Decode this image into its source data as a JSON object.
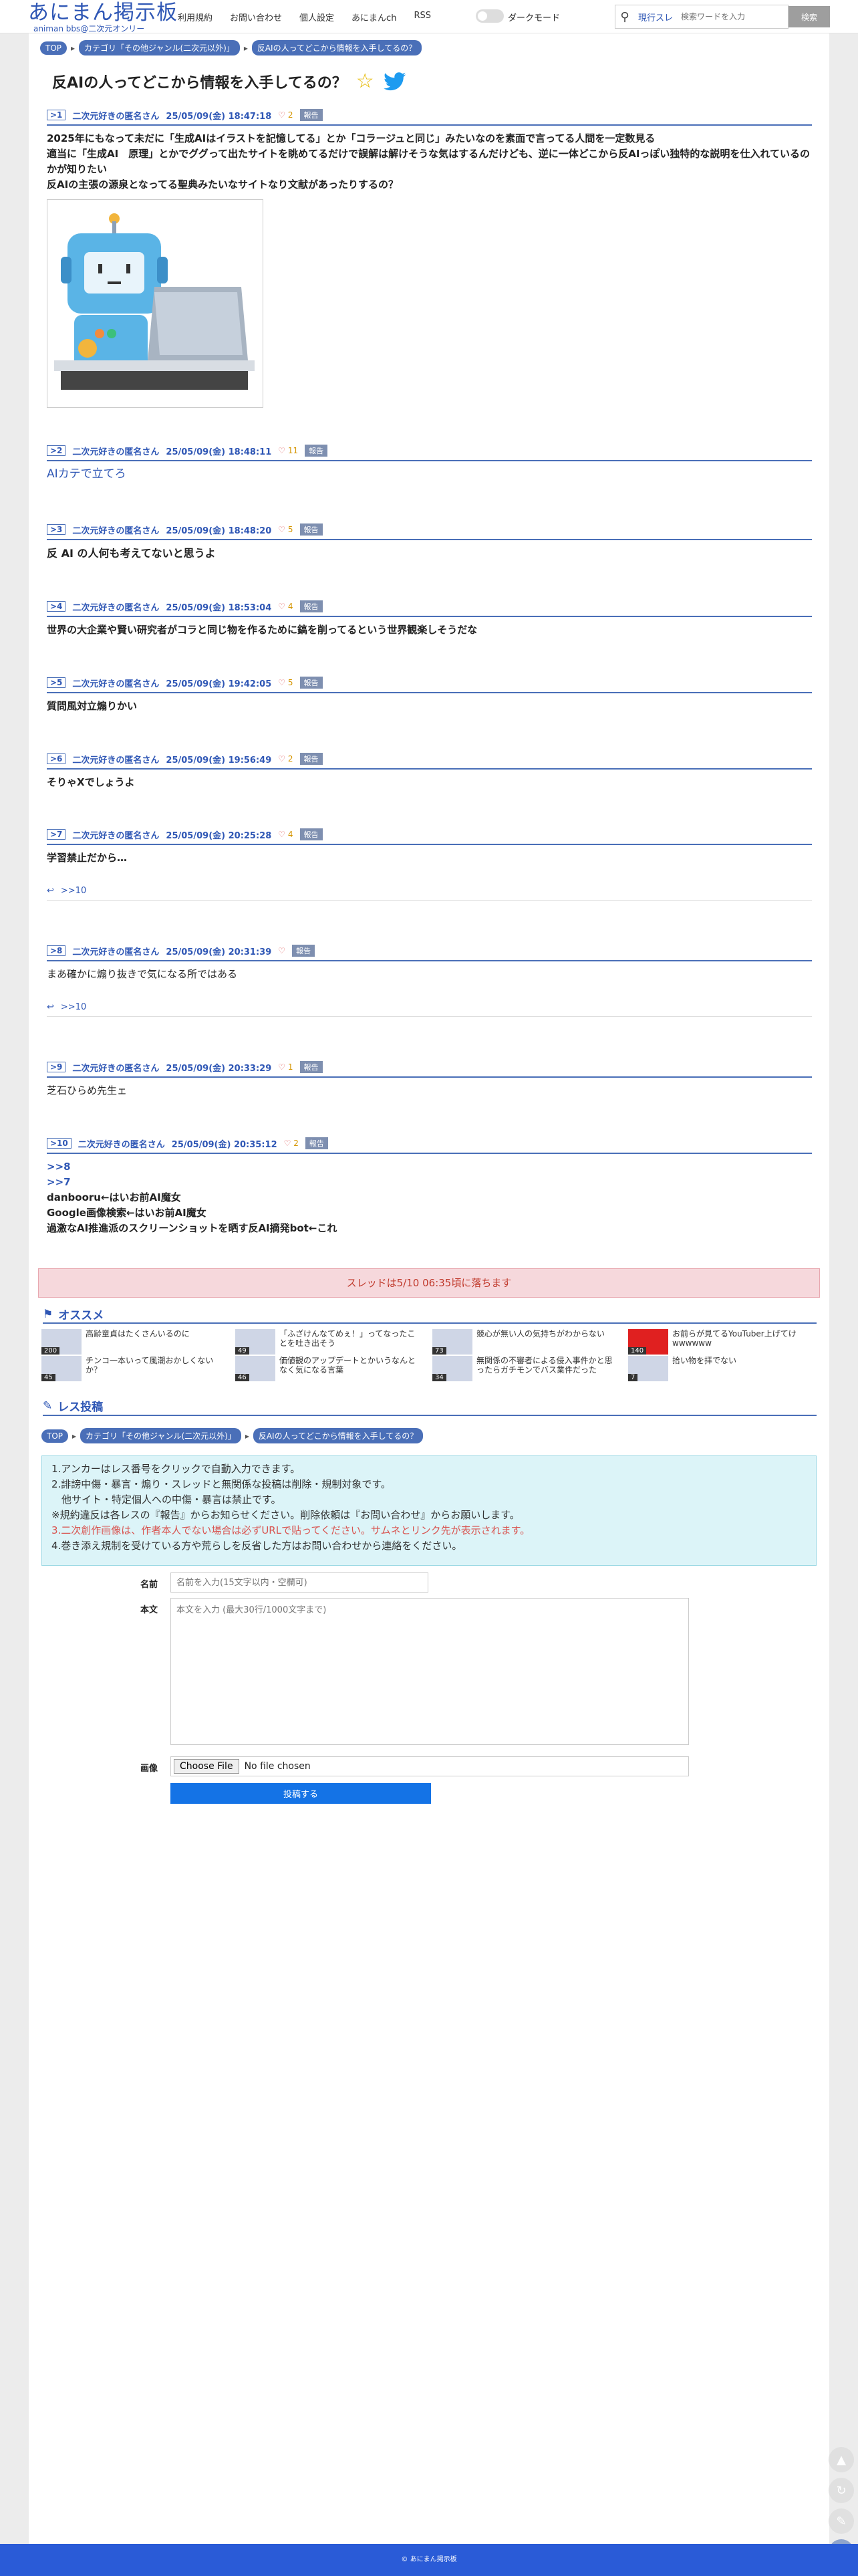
{
  "header": {
    "logo_main": "あにまん掲示板",
    "logo_sub": "animan bbs@二次元オンリー",
    "nav": [
      "利用規約",
      "お問い合わせ",
      "個人設定",
      "あにまんch",
      "RSS"
    ],
    "dark_mode": "ダークモード",
    "search_mode": "現行スレ",
    "search_placeholder": "検索ワードを入力",
    "search_button": "検索"
  },
  "breadcrumb": [
    "TOP",
    "カテゴリ「その他ジャンル(二次元以外)」",
    "反AIの人ってどこから情報を入手してるの？"
  ],
  "thread": {
    "title": "反AIの人ってどこから情報を入手してるの？"
  },
  "posts": [
    {
      "num": ">1",
      "name": "二次元好きの匿名さん",
      "date": "25/05/09(金) 18:47:18",
      "likes": "2",
      "report": "報告",
      "lines": [
        "2025年にもなって未だに「生成AIはイラストを記憶してる」とか「コラージュと同じ」みたいなのを素面で言ってる人間を一定数見る",
        "適当に「生成AI　原理」とかでググって出たサイトを眺めてるだけで誤解は解けそうな気はするんだけども、逆に一体どこから反AIっぽい独特的な説明を仕入れているのかが知りたい",
        "反AIの主張の源泉となってる聖典みたいなサイトなり文献があったりするの？"
      ]
    },
    {
      "num": ">2",
      "name": "二次元好きの匿名さん",
      "date": "25/05/09(金) 18:48:11",
      "likes": "11",
      "report": "報告",
      "lines": [
        "AIカテで立てろ"
      ]
    },
    {
      "num": ">3",
      "name": "二次元好きの匿名さん",
      "date": "25/05/09(金) 18:48:20",
      "likes": "5",
      "report": "報告",
      "lines": [
        "反 AI の人何も考えてないと思うよ"
      ]
    },
    {
      "num": ">4",
      "name": "二次元好きの匿名さん",
      "date": "25/05/09(金) 18:53:04",
      "likes": "4",
      "report": "報告",
      "lines": [
        "世界の大企業や賢い研究者がコラと同じ物を作るために鎬を削ってるという世界観楽しそうだな"
      ]
    },
    {
      "num": ">5",
      "name": "二次元好きの匿名さん",
      "date": "25/05/09(金) 19:42:05",
      "likes": "5",
      "report": "報告",
      "lines": [
        "質問風対立煽りかい"
      ]
    },
    {
      "num": ">6",
      "name": "二次元好きの匿名さん",
      "date": "25/05/09(金) 19:56:49",
      "likes": "2",
      "report": "報告",
      "lines": [
        "そりゃXでしょうよ"
      ]
    },
    {
      "num": ">7",
      "name": "二次元好きの匿名さん",
      "date": "25/05/09(金) 20:25:28",
      "likes": "4",
      "report": "報告",
      "lines": [
        "学習禁止だから…"
      ],
      "reply": ">>10"
    },
    {
      "num": ">8",
      "name": "二次元好きの匿名さん",
      "date": "25/05/09(金) 20:31:39",
      "likes": "",
      "report": "報告",
      "lines": [
        "まあ確かに煽り抜きで気になる所ではある"
      ],
      "reply": ">>10"
    },
    {
      "num": ">9",
      "name": "二次元好きの匿名さん",
      "date": "25/05/09(金) 20:33:29",
      "likes": "1",
      "report": "報告",
      "lines": [
        "芝石ひらめ先生ェ"
      ]
    },
    {
      "num": ">10",
      "name": "二次元好きの匿名さん",
      "date": "25/05/09(金) 20:35:12",
      "likes": "2",
      "report": "報告",
      "anchors": [
        ">>8",
        ">>7"
      ],
      "lines": [
        "danbooru←はいお前AI魔女",
        "Google画像検索←はいお前AI魔女",
        "過激なAI推進派のスクリーンショットを晒す反AI摘発bot←これ"
      ]
    }
  ],
  "banner": "スレッドは5/10 06:35頃に落ちます",
  "recommend": {
    "title": "オススメ",
    "items": [
      {
        "text": "高齢童貞はたくさんいるのに",
        "count": "200"
      },
      {
        "text": "「ふざけんなてめぇ！」ってなったことを吐き出そう",
        "count": "49"
      },
      {
        "text": "競心が無い人の気持ちがわからない",
        "count": "73"
      },
      {
        "text": "お前らが見てるYouTuber上げてけwwwwww",
        "count": "140"
      },
      {
        "text": "チンコ一本いって風潮おかしくないか？",
        "count": "45"
      },
      {
        "text": "価値観のアップデートとかいうなんとなく気になる言葉",
        "count": "46"
      },
      {
        "text": "無関係の不審者による侵入事件かと思ったらガチモンでバス業件だった",
        "count": "34"
      },
      {
        "text": "拾い物を拝でない",
        "count": "7"
      }
    ]
  },
  "form": {
    "title": "レス投稿",
    "rules": [
      "1.アンカーはレス番号をクリックで自動入力できます。",
      "2.誹謗中傷・暴言・煽り・スレッドと無関係な投稿は削除・規制対象です。",
      "　他サイト・特定個人への中傷・暴言は禁止です。",
      "※規約違反は各レスの『報告』からお知らせください。削除依頼は『お問い合わせ』からお願いします。",
      "3.二次創作画像は、作者本人でない場合は必ずURLで貼ってください。サムネとリンク先が表示されます。",
      "4.巻き添え規制を受けている方や荒らしを反省した方はお問い合わせから連絡をください。"
    ],
    "name_label": "名前",
    "name_placeholder": "名前を入力(15文字以内・空欄可)",
    "body_label": "本文",
    "body_placeholder": "本文を入力 (最大30行/1000文字まで)",
    "image_label": "画像",
    "file_button": "Choose File",
    "file_status": "No file chosen",
    "submit": "投稿する"
  },
  "footer": "© あにまん掲示板",
  "colors": {
    "accent": "#2f57b5",
    "breadcrumb": "#4a6fb8",
    "submit": "#1473e6",
    "footer": "#2a5bd7",
    "banner_bg": "#f6d8dc",
    "rules_bg": "#dcf4f8"
  }
}
